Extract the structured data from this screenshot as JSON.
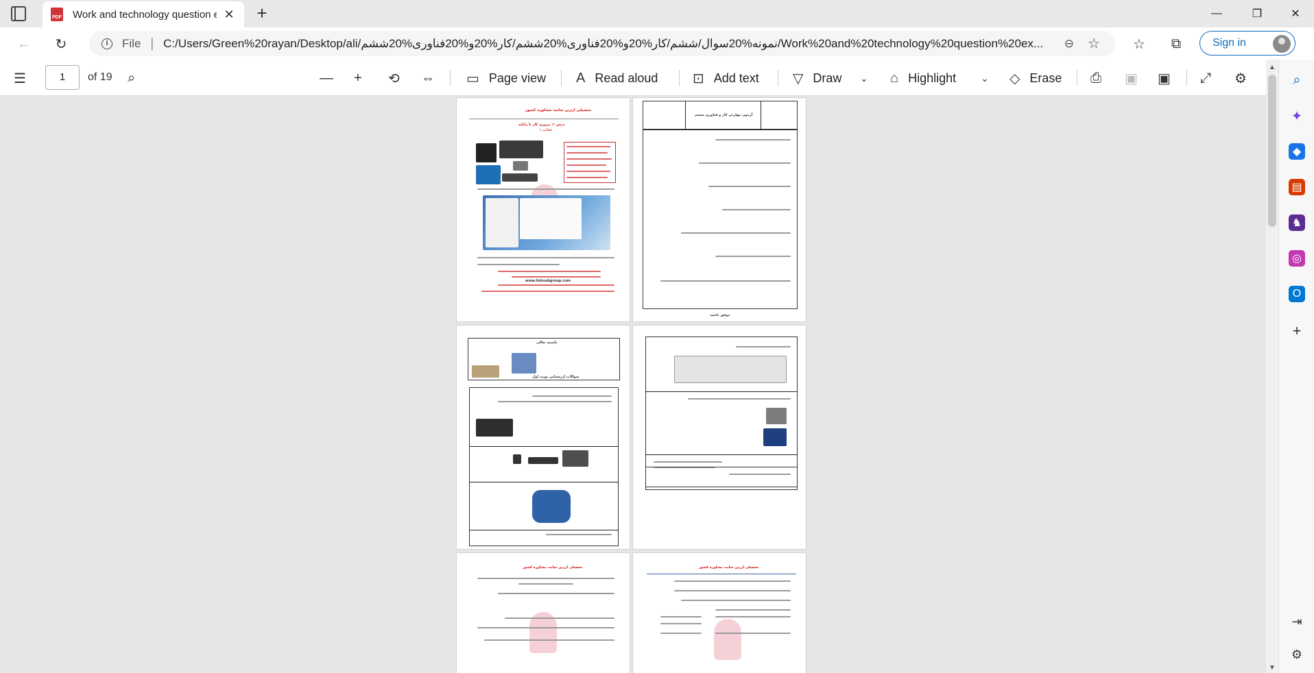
{
  "browser": {
    "tab_title": "Work and technology question e",
    "url_scheme_label": "File",
    "url": "C:/Users/Green%20rayan/Desktop/ali/نمونه%20سوال/ششم/کار%20و%20فناوری%20ششم/کار%20و%20فناوری%20ششم/Work%20and%20technology%20question%20ex...",
    "signin_label": "Sign in",
    "pdf_icon_label": "PDF"
  },
  "pdf_toolbar": {
    "page_number": "1",
    "page_total": "of 19",
    "page_view": "Page view",
    "read_aloud": "Read aloud",
    "add_text": "Add text",
    "draw": "Draw",
    "highlight": "Highlight",
    "erase": "Erase"
  },
  "icons": {
    "tab_actions": "tab-actions-icon",
    "close": "close-icon",
    "new_tab": "plus-icon",
    "back": "back-arrow-icon",
    "refresh": "refresh-icon",
    "info": "info-icon",
    "zoom": "zoom-icon",
    "favorite_add": "star-plus-icon",
    "favorites": "favorites-icon",
    "collections": "collections-icon",
    "more": "more-icon"
  },
  "sidebar_colors": {
    "search": "#0f6cbd",
    "copilot": "#7b3fe4",
    "shopping": "#1a73e8",
    "tools": "#d83b01",
    "games": "#5c2d91",
    "office": "#c239b3",
    "outlook": "#0078d4"
  },
  "pages_text": {
    "p1_header": "تحصیلی ارزین سایت مشاوره کشور",
    "p1_sub": "درس ۱: مروری کار با رایانه",
    "p1_heading": "فعالیت ۱",
    "p2_title": "آزمون مهارتی کار و فناوری ششم",
    "p2_footer": "موفق باشید",
    "p3_title": "باسمه تعالی",
    "p3_sub": "سوالات ارزشیابی نوبت اول",
    "p5_header": "تحصیلی ارزین سایت مشاوره کشور",
    "p6_header": "تحصیلی ارزین سایت مشاوره کشور",
    "site": "www.linksubgroup.com"
  }
}
